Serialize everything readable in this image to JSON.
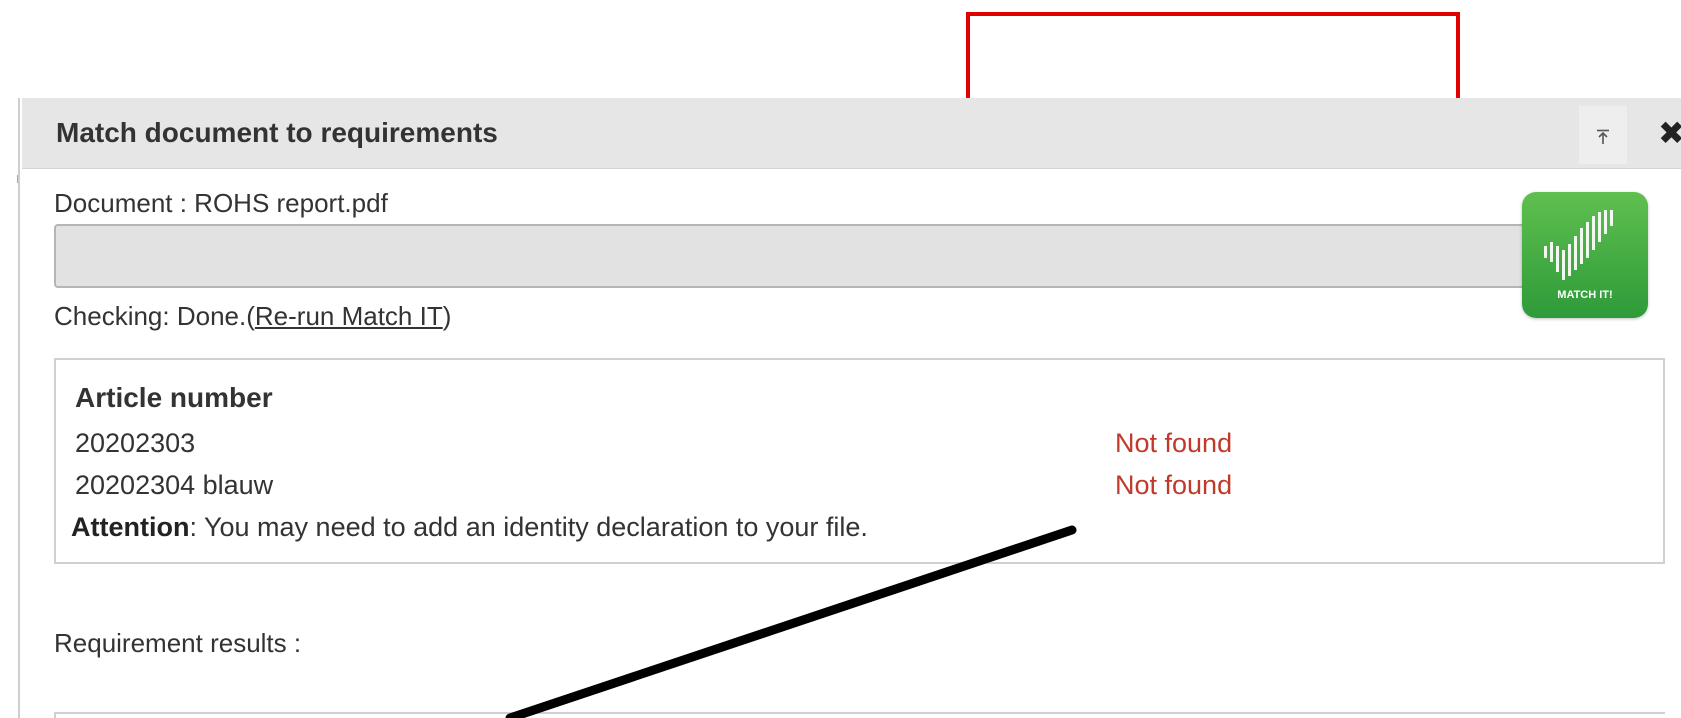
{
  "dialog": {
    "title": "Match document to requirements",
    "pin_icon": "pin-to-top-icon",
    "close_icon": "close-icon",
    "close_glyph": "✖"
  },
  "document": {
    "label": "Document : ROHS report.pdf",
    "progress": 1.0
  },
  "status": {
    "prefix": "Checking: Done.(",
    "link": "Re-run Match IT",
    "suffix": ")"
  },
  "logo": {
    "icon": "matchit-logo-icon",
    "text": "MATCH IT!"
  },
  "articles": {
    "heading": "Article number",
    "rows": [
      {
        "number": "20202303",
        "status": "Not found"
      },
      {
        "number": "20202304 blauw",
        "status": "Not found"
      }
    ],
    "attention_label": "Attention",
    "attention_text": ": You may need to add an identity declaration to your file."
  },
  "requirements": {
    "label": "Requirement results :"
  },
  "colors": {
    "header_bg": "#e6e6e6",
    "not_found": "#c0392b",
    "logo_green": "#3aa83f",
    "annotation_red": "#e00000",
    "annotation_black": "#000000"
  }
}
